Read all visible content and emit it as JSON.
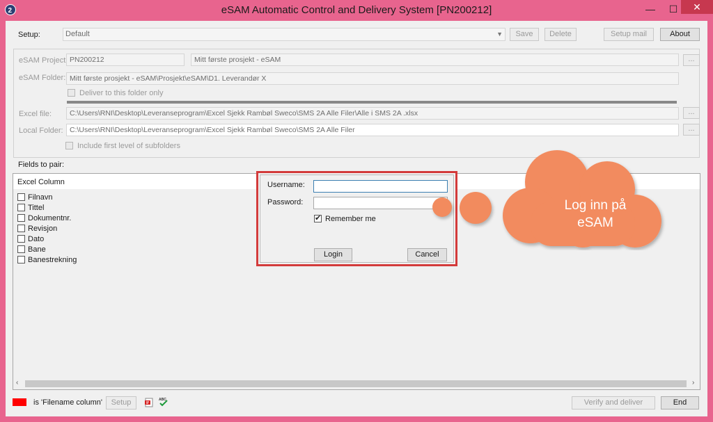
{
  "window": {
    "title": "eSAM Automatic Control and Delivery System [PN200212]",
    "minimize": "—",
    "maximize": "☐",
    "close": "✕",
    "accent": "#e8648e"
  },
  "setup": {
    "label": "Setup:",
    "value": "Default",
    "save": "Save",
    "delete": "Delete",
    "setup_mail": "Setup mail",
    "about": "About"
  },
  "project": {
    "esam_project_label": "eSAM Project:",
    "project_code": "PN200212",
    "project_name": "Mitt første prosjekt - eSAM",
    "esam_folder_label": "eSAM Folder:",
    "folder_path": "Mitt første prosjekt - eSAM\\Prosjekt\\eSAM\\D1. Leverandør X",
    "deliver_only": "Deliver to this folder only",
    "excel_file_label": "Excel file:",
    "excel_path": "C:\\Users\\RNI\\Desktop\\Leveranseprogram\\Excel Sjekk Rambøl Sweco\\SMS 2A Alle Filer\\Alle i SMS 2A .xlsx",
    "local_folder_label": "Local Folder:",
    "local_path": "C:\\Users\\RNI\\Desktop\\Leveranseprogram\\Excel Sjekk Rambøl Sweco\\SMS 2A Alle Filer",
    "include_subfolders": "Include first level of subfolders",
    "browse": "..."
  },
  "fields": {
    "label": "Fields to pair:",
    "column_header": "Excel Column",
    "items": [
      "Filnavn",
      "Tittel",
      "Dokumentnr.",
      "Revisjon",
      "Dato",
      "Bane",
      "Banestrekning"
    ]
  },
  "login": {
    "username_label": "Username:",
    "password_label": "Password:",
    "remember": "Remember me",
    "remember_checked": true,
    "login": "Login",
    "cancel": "Cancel"
  },
  "callout": {
    "text": "Log inn på eSAM",
    "color": "#f28b5e"
  },
  "footer": {
    "filename_legend": "is 'Filename column'",
    "setup": "Setup",
    "verify": "Verify and deliver",
    "end": "End",
    "pdf_icon": "pdf-icon",
    "spell_icon": "spellcheck-icon"
  },
  "scroll": {
    "left": "‹",
    "right": "›"
  }
}
